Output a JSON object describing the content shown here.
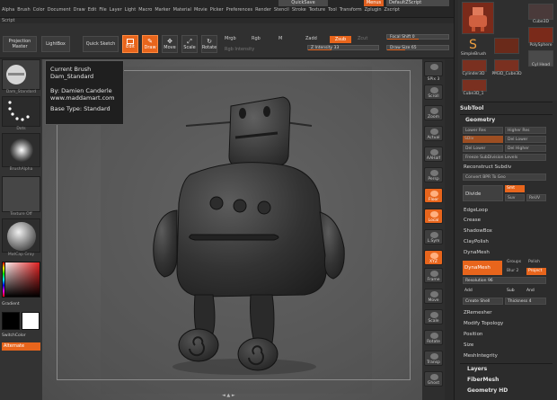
{
  "menubar": {
    "items": [
      "Alpha",
      "Brush",
      "Color",
      "Document",
      "Draw",
      "Edit",
      "File",
      "Layer",
      "Light",
      "Macro",
      "Marker",
      "Material",
      "Movie",
      "Picker",
      "Preferences",
      "Render",
      "Stencil",
      "Stroke",
      "Texture",
      "Tool",
      "Transform",
      "Zplugin",
      "Zscript"
    ],
    "quicksave": "QuickSave",
    "top_orange": "Menus",
    "top_gray": "DefaultZScript"
  },
  "script_label": "Script",
  "top_shelf": {
    "projection_master": "Projection Master",
    "lightbox": "LightBox",
    "quick_sketch": "Quick Sketch",
    "edit": "Edit",
    "draw": "Draw",
    "move": "Move",
    "scale": "Scale",
    "rotate": "Rotate",
    "mrgb": "Mrgb",
    "rgb": "Rgb",
    "m": "M",
    "rgb_intensity": "Rgb Intensity",
    "zadd": "Zadd",
    "zsub": "Zsub",
    "zcut": "Zcut",
    "z_intensity": "Z Intensity 33",
    "focal_shift": "Focal Shift 0",
    "draw_size": "Draw Size 65"
  },
  "left_panel": {
    "brush_label": "Dam_Standard",
    "stroke_label": "Dots",
    "alpha_label": "BrushAlpha",
    "texture_label": "Texture Off",
    "material_label": "MatCap Gray",
    "gradient_label": "Gradient",
    "switchcolor_label": "SwitchColor",
    "alternate_label": "Alternate"
  },
  "tooltip": {
    "line1": "Current Brush",
    "line2": "Dam_Standard",
    "line3": "By: Damien Canderle",
    "line4": "www.maddamart.com",
    "line5": "Base Type: Standard"
  },
  "canvas": {
    "footer": "◄ ▲ ►"
  },
  "right_shelf": {
    "spix": "SPix 3",
    "buttons": [
      "Scroll",
      "Zoom",
      "Actual",
      "AAHalf",
      "Persp",
      "Floor",
      "Local",
      "L.Sym",
      "XYZ",
      "Frame",
      "Move",
      "Scale",
      "Rotate",
      "Transp",
      "Ghost"
    ]
  },
  "right_panel": {
    "thumbs": [
      "Cube3D",
      "PolySphere",
      "Cyl Head",
      "SimpleBrush",
      "Cylinder3D",
      "PM3D_Cube3D",
      "Cube3D_1"
    ],
    "subtool": "SubTool",
    "geometry": "Geometry",
    "geo_rows": [
      {
        "left": "Lower Res",
        "right": "Higher Res"
      },
      {
        "left": "SDiv",
        "right": "Del Lower"
      },
      {
        "left": "Del Lower",
        "right": "Del Higher"
      },
      {
        "left": "Freeze SubDivision Levels"
      }
    ],
    "reconstruct": "Reconstruct Subdiv",
    "convert_bpr": "Convert BPR To Geo",
    "divide": "Divide",
    "smt": "Smt",
    "suv": "Suv",
    "rsmt": "ReUV",
    "items": [
      "EdgeLoop",
      "Crease",
      "ShadowBox",
      "ClayPolish",
      "DynaMesh"
    ],
    "dynamesh_btn": "DynaMesh",
    "groups": "Groups",
    "polish": "Polish",
    "blur": "Blur 2",
    "project": "Project",
    "resolution": "Resolution 96",
    "add": "Add",
    "sub": "Sub",
    "and": "And",
    "create_shell": "Create Shell",
    "thickness": "Thickness 4",
    "items2": [
      "ZRemesher",
      "Modify Topology",
      "Position",
      "Size",
      "MeshIntegrity"
    ],
    "layers": "Layers",
    "fibermesh": "FiberMesh",
    "geometry_hd": "Geometry HD"
  }
}
